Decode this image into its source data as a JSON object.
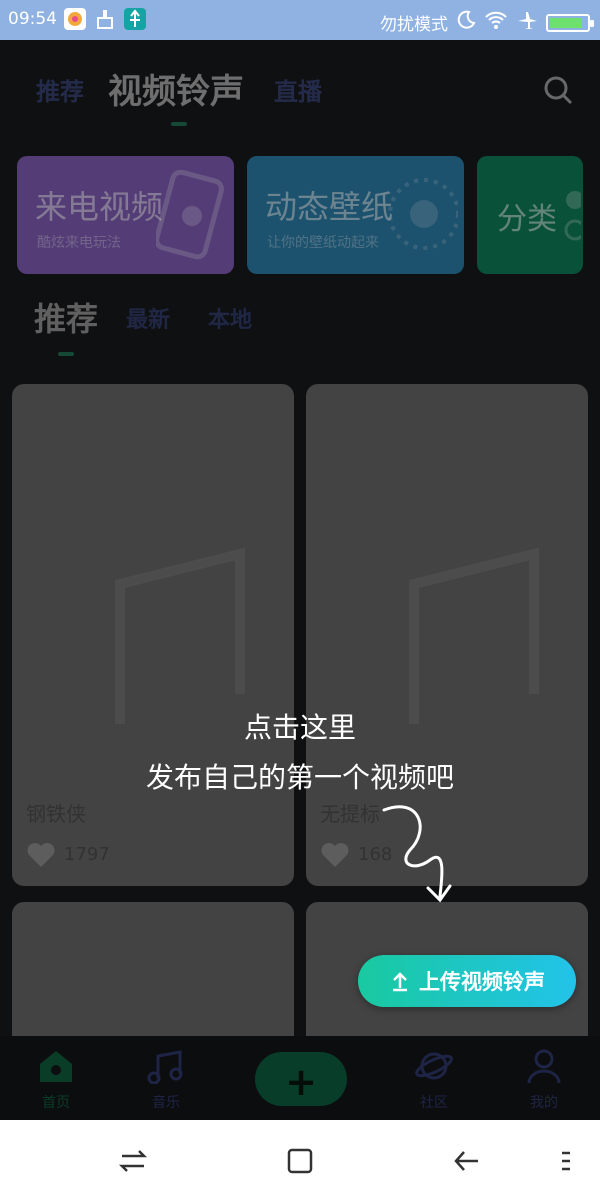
{
  "status_bar": {
    "time": "09:54",
    "mode": "勿扰模式",
    "battery_percent": 90
  },
  "top_tabs": [
    {
      "label": "推荐",
      "active": false
    },
    {
      "label": "视频铃声",
      "active": true
    },
    {
      "label": "直播",
      "active": false
    }
  ],
  "features": [
    {
      "title": "来电视频",
      "subtitle": "酷炫来电玩法",
      "color": "#7c5ab0"
    },
    {
      "title": "动态壁纸",
      "subtitle": "让你的壁纸动起来",
      "color": "#2a79a3"
    },
    {
      "title": "分类",
      "subtitle": "",
      "color": "#0e7a55"
    }
  ],
  "sub_tabs": [
    {
      "label": "推荐",
      "active": true
    },
    {
      "label": "最新",
      "active": false
    },
    {
      "label": "本地",
      "active": false
    }
  ],
  "cards": [
    {
      "name": "钢铁侠",
      "likes": "1797"
    },
    {
      "name": "无提标",
      "likes": "168"
    },
    {
      "name": "",
      "likes": ""
    },
    {
      "name": "",
      "likes": ""
    }
  ],
  "hint": {
    "line1": "点击这里",
    "line2": "发布自己的第一个视频吧"
  },
  "upload_button": {
    "label": "上传视频铃声"
  },
  "bottom_nav": [
    {
      "label": "首页",
      "icon": "home-icon",
      "active": true
    },
    {
      "label": "音乐",
      "icon": "music-icon",
      "active": false
    },
    {
      "label": "+",
      "icon": "add-icon",
      "active": false
    },
    {
      "label": "社区",
      "icon": "planet-icon",
      "active": false
    },
    {
      "label": "我的",
      "icon": "user-icon",
      "active": false
    }
  ]
}
